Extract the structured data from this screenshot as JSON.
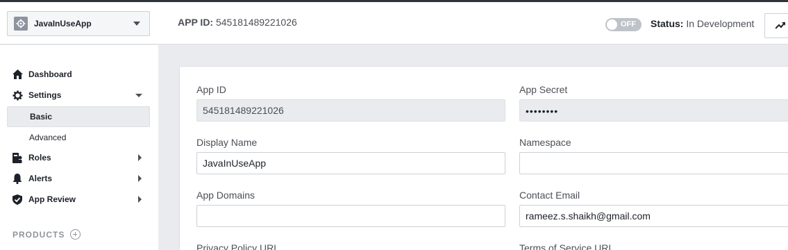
{
  "header": {
    "app_name": "JavaInUseApp",
    "app_id_label": "APP ID:",
    "app_id_value": "545181489221026",
    "toggle_text": "OFF",
    "status_label": "Status:",
    "status_value": "In Development"
  },
  "sidebar": {
    "items": [
      {
        "label": "Dashboard",
        "icon": "home-icon"
      },
      {
        "label": "Settings",
        "icon": "gear-icon"
      },
      {
        "label": "Roles",
        "icon": "roles-icon"
      },
      {
        "label": "Alerts",
        "icon": "bell-icon"
      },
      {
        "label": "App Review",
        "icon": "shield-icon"
      }
    ],
    "settings_sub": [
      {
        "label": "Basic",
        "active": true
      },
      {
        "label": "Advanced",
        "active": false
      }
    ],
    "products_label": "PRODUCTS"
  },
  "form": {
    "app_id_label": "App ID",
    "app_id_value": "545181489221026",
    "app_secret_label": "App Secret",
    "app_secret_value": "••••••••",
    "display_name_label": "Display Name",
    "display_name_value": "JavaInUseApp",
    "namespace_label": "Namespace",
    "namespace_value": "",
    "app_domains_label": "App Domains",
    "app_domains_value": "",
    "contact_email_label": "Contact Email",
    "contact_email_value": "rameez.s.shaikh@gmail.com",
    "privacy_label": "Privacy Policy URL",
    "terms_label": "Terms of Service URL"
  },
  "colors": {
    "accent": "#4267b2",
    "toggle_off": "#bec3c9",
    "background": "#e9ebee"
  }
}
